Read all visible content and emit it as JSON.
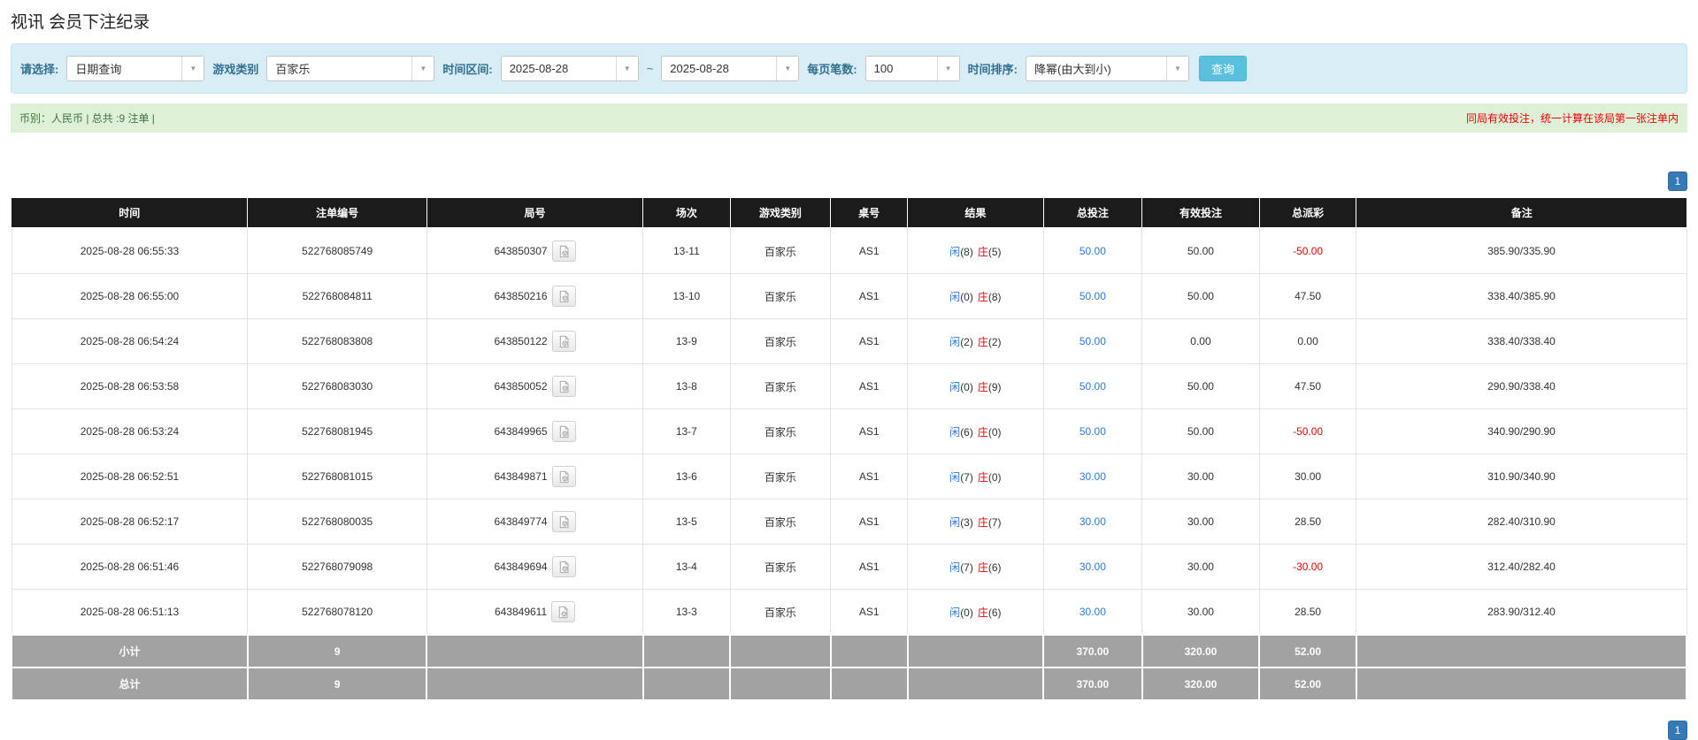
{
  "page": {
    "title": "视讯 会员下注纪录"
  },
  "colors": {
    "accent_blue": "#2b7bdd",
    "negative_red": "#ee0000",
    "filter_bg": "#d9edf7",
    "notice_bg": "#dff0d8",
    "notice_green_text": "#3c763d",
    "header_black": "#1b1b1b",
    "summary_gray": "#a2a2a2",
    "query_btn": "#5bc0de",
    "pager_btn": "#337ab7"
  },
  "filters": {
    "select_label": "请选择:",
    "select_value": "日期查询",
    "game_label": "游戏类别",
    "game_value": "百家乐",
    "range_label": "时间区间:",
    "date_from": "2025-08-28",
    "range_separator": "~",
    "date_to": "2025-08-28",
    "page_size_label": "每页笔数:",
    "page_size_value": "100",
    "sort_label": "时间排序:",
    "sort_value": "降幂(由大到小)",
    "query_button": "查询",
    "dropdown_arrow": "▼"
  },
  "notice": {
    "left": "币别：人民币 | 总共 :9 注单 |",
    "right": "同局有效投注，统一计算在该局第一张注单内"
  },
  "pagination": {
    "current_page": "1"
  },
  "table": {
    "headers": [
      "时间",
      "注单编号",
      "局号",
      "场次",
      "游戏类别",
      "桌号",
      "结果",
      "总投注",
      "有效投注",
      "总派彩",
      "备注"
    ],
    "rows": [
      {
        "time": "2025-08-28 06:55:33",
        "bet_id": "522768085749",
        "round_id": "643850307",
        "session": "13-11",
        "game": "百家乐",
        "table_no": "AS1",
        "result_p": "闲",
        "result_p_n": "(8)",
        "result_b": "庄",
        "result_b_n": "(5)",
        "total_bet": "50.00",
        "valid_bet": "50.00",
        "payout": "-50.00",
        "remark": "385.90/335.90"
      },
      {
        "time": "2025-08-28 06:55:00",
        "bet_id": "522768084811",
        "round_id": "643850216",
        "session": "13-10",
        "game": "百家乐",
        "table_no": "AS1",
        "result_p": "闲",
        "result_p_n": "(0)",
        "result_b": "庄",
        "result_b_n": "(8)",
        "total_bet": "50.00",
        "valid_bet": "50.00",
        "payout": "47.50",
        "remark": "338.40/385.90"
      },
      {
        "time": "2025-08-28 06:54:24",
        "bet_id": "522768083808",
        "round_id": "643850122",
        "session": "13-9",
        "game": "百家乐",
        "table_no": "AS1",
        "result_p": "闲",
        "result_p_n": "(2)",
        "result_b": "庄",
        "result_b_n": "(2)",
        "total_bet": "50.00",
        "valid_bet": "0.00",
        "payout": "0.00",
        "remark": "338.40/338.40"
      },
      {
        "time": "2025-08-28 06:53:58",
        "bet_id": "522768083030",
        "round_id": "643850052",
        "session": "13-8",
        "game": "百家乐",
        "table_no": "AS1",
        "result_p": "闲",
        "result_p_n": "(0)",
        "result_b": "庄",
        "result_b_n": "(9)",
        "total_bet": "50.00",
        "valid_bet": "50.00",
        "payout": "47.50",
        "remark": "290.90/338.40"
      },
      {
        "time": "2025-08-28 06:53:24",
        "bet_id": "522768081945",
        "round_id": "643849965",
        "session": "13-7",
        "game": "百家乐",
        "table_no": "AS1",
        "result_p": "闲",
        "result_p_n": "(6)",
        "result_b": "庄",
        "result_b_n": "(0)",
        "total_bet": "50.00",
        "valid_bet": "50.00",
        "payout": "-50.00",
        "remark": "340.90/290.90"
      },
      {
        "time": "2025-08-28 06:52:51",
        "bet_id": "522768081015",
        "round_id": "643849871",
        "session": "13-6",
        "game": "百家乐",
        "table_no": "AS1",
        "result_p": "闲",
        "result_p_n": "(7)",
        "result_b": "庄",
        "result_b_n": "(0)",
        "total_bet": "30.00",
        "valid_bet": "30.00",
        "payout": "30.00",
        "remark": "310.90/340.90"
      },
      {
        "time": "2025-08-28 06:52:17",
        "bet_id": "522768080035",
        "round_id": "643849774",
        "session": "13-5",
        "game": "百家乐",
        "table_no": "AS1",
        "result_p": "闲",
        "result_p_n": "(3)",
        "result_b": "庄",
        "result_b_n": "(7)",
        "total_bet": "30.00",
        "valid_bet": "30.00",
        "payout": "28.50",
        "remark": "282.40/310.90"
      },
      {
        "time": "2025-08-28 06:51:46",
        "bet_id": "522768079098",
        "round_id": "643849694",
        "session": "13-4",
        "game": "百家乐",
        "table_no": "AS1",
        "result_p": "闲",
        "result_p_n": "(7)",
        "result_b": "庄",
        "result_b_n": "(6)",
        "total_bet": "30.00",
        "valid_bet": "30.00",
        "payout": "-30.00",
        "remark": "312.40/282.40"
      },
      {
        "time": "2025-08-28 06:51:13",
        "bet_id": "522768078120",
        "round_id": "643849611",
        "session": "13-3",
        "game": "百家乐",
        "table_no": "AS1",
        "result_p": "闲",
        "result_p_n": "(0)",
        "result_b": "庄",
        "result_b_n": "(6)",
        "total_bet": "30.00",
        "valid_bet": "30.00",
        "payout": "28.50",
        "remark": "283.90/312.40"
      }
    ],
    "subtotal": {
      "label": "小计",
      "count": "9",
      "total_bet": "370.00",
      "valid_bet": "320.00",
      "payout": "52.00"
    },
    "total": {
      "label": "总计",
      "count": "9",
      "total_bet": "370.00",
      "valid_bet": "320.00",
      "payout": "52.00"
    }
  }
}
